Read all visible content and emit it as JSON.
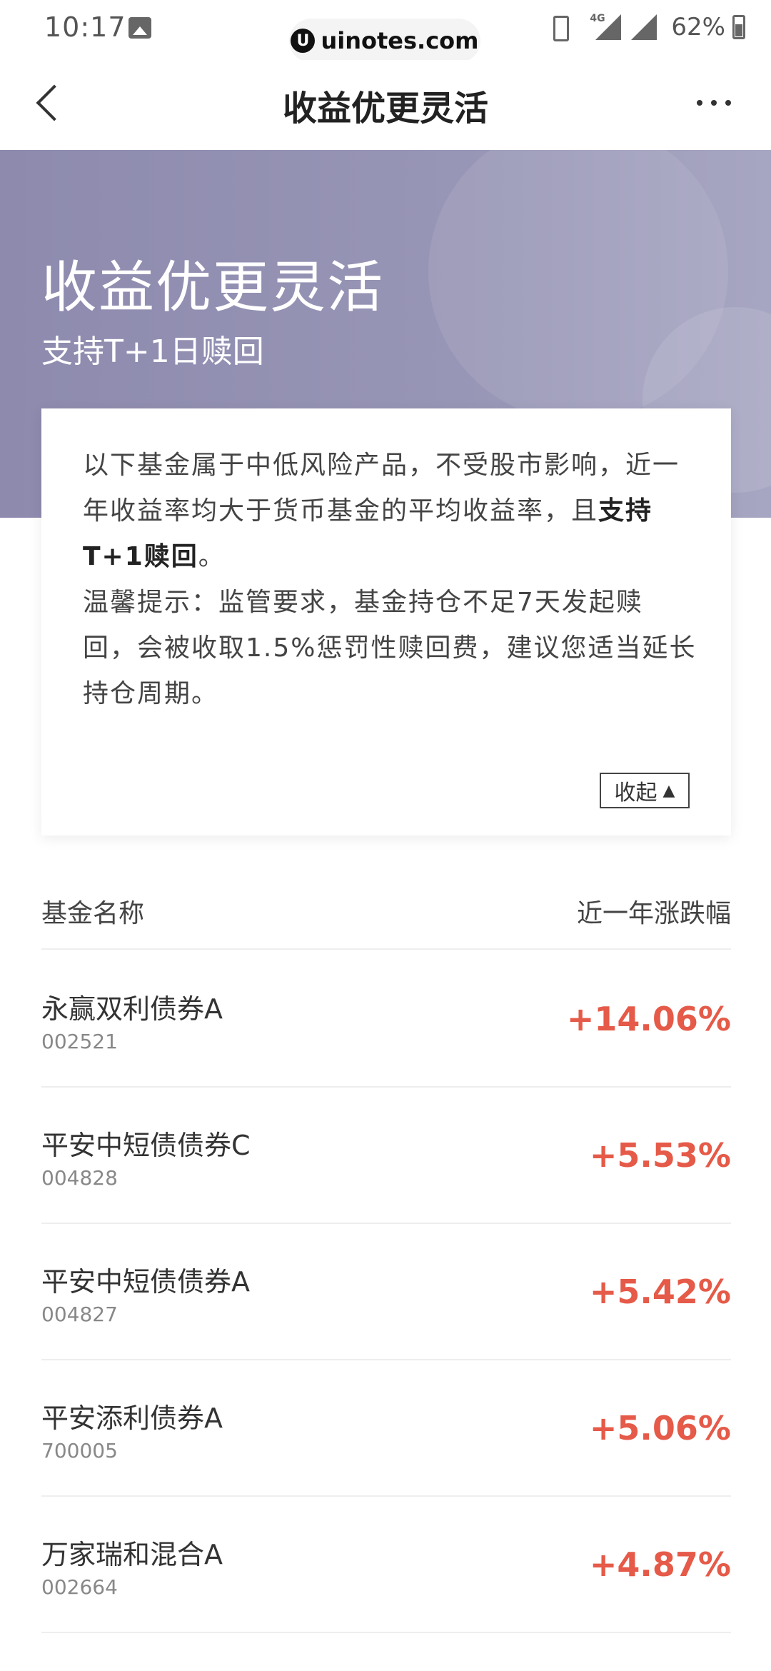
{
  "status_bar": {
    "time": "10:17",
    "watermark": "uinotes.com",
    "network": "4G",
    "battery": "62%"
  },
  "nav": {
    "title": "收益优更灵活"
  },
  "banner": {
    "title": "收益优更灵活",
    "subtitle": "支持T+1日赎回"
  },
  "info": {
    "text_part1": "以下基金属于中低风险产品，不受股市影响，近一年收益率均大于货币基金的平均收益率，且",
    "text_bold": "支持T+1赎回",
    "text_part2": "。",
    "tip": "温馨提示：监管要求，基金持仓不足7天发起赎回，会被收取1.5%惩罚性赎回费，建议您适当延长持仓周期。",
    "collapse_label": "收起"
  },
  "list": {
    "header_name": "基金名称",
    "header_change": "近一年涨跌幅",
    "funds": [
      {
        "name": "永赢双利债券A",
        "code": "002521",
        "change": "+14.06%"
      },
      {
        "name": "平安中短债债券C",
        "code": "004828",
        "change": "+5.53%"
      },
      {
        "name": "平安中短债债券A",
        "code": "004827",
        "change": "+5.42%"
      },
      {
        "name": "平安添利债券A",
        "code": "700005",
        "change": "+5.06%"
      },
      {
        "name": "万家瑞和混合A",
        "code": "002664",
        "change": "+4.87%"
      }
    ]
  },
  "colors": {
    "banner": "#9896b6",
    "positive": "#e55a48"
  }
}
